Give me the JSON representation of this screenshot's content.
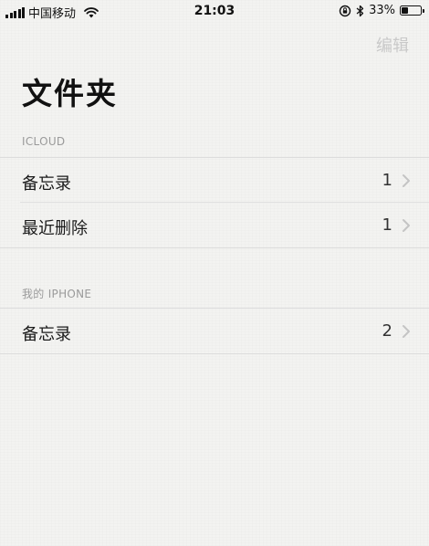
{
  "status_bar": {
    "carrier": "中国移动",
    "time": "21:03",
    "battery_percent": "33%",
    "battery_level": 0.33,
    "icons": [
      "signal-icon",
      "wifi-icon",
      "orientation-lock-icon",
      "bluetooth-icon",
      "battery-icon"
    ]
  },
  "nav": {
    "edit_label": "编辑"
  },
  "title": "文件夹",
  "sections": [
    {
      "header": "ICLOUD",
      "rows": [
        {
          "label": "备忘录",
          "count": "1"
        },
        {
          "label": "最近删除",
          "count": "1"
        }
      ]
    },
    {
      "header": "我的 IPHONE",
      "rows": [
        {
          "label": "备忘录",
          "count": "2"
        }
      ]
    }
  ],
  "colors": {
    "background": "#f3f3f1",
    "edit_disabled": "#c9c9c9",
    "section_header": "#9a9a9a",
    "separator": "#dcdcdc"
  }
}
